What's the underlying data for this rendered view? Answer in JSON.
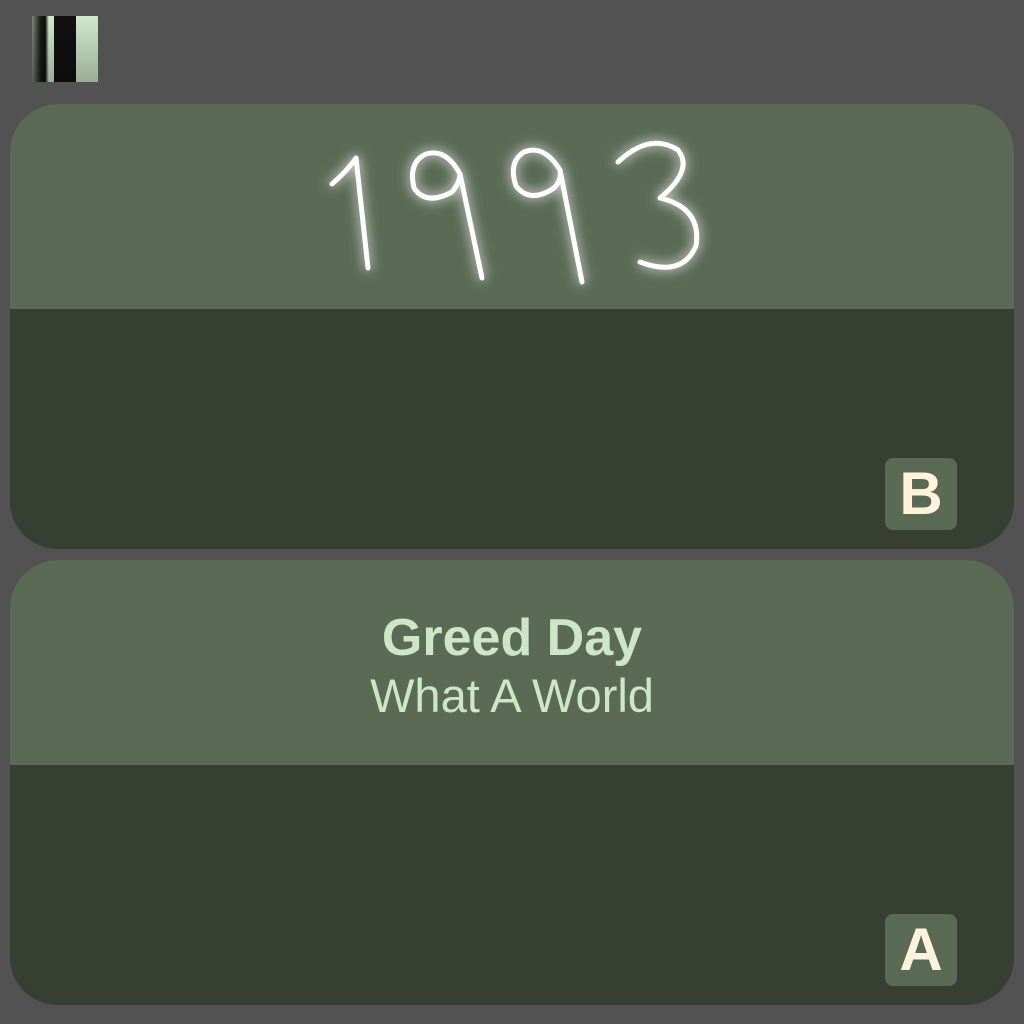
{
  "controls": {
    "pause_icon": "pause-icon"
  },
  "cards": {
    "b": {
      "year": "1993",
      "label": "B"
    },
    "a": {
      "artist": "Greed Day",
      "title": "What A World",
      "label": "A"
    }
  },
  "colors": {
    "background": "#525252",
    "card_top": "#5a6a55",
    "card_bottom": "#373f33",
    "text_light_green": "#cde6c8",
    "badge_text": "#fff3dc",
    "handwriting": "#ffffff"
  }
}
